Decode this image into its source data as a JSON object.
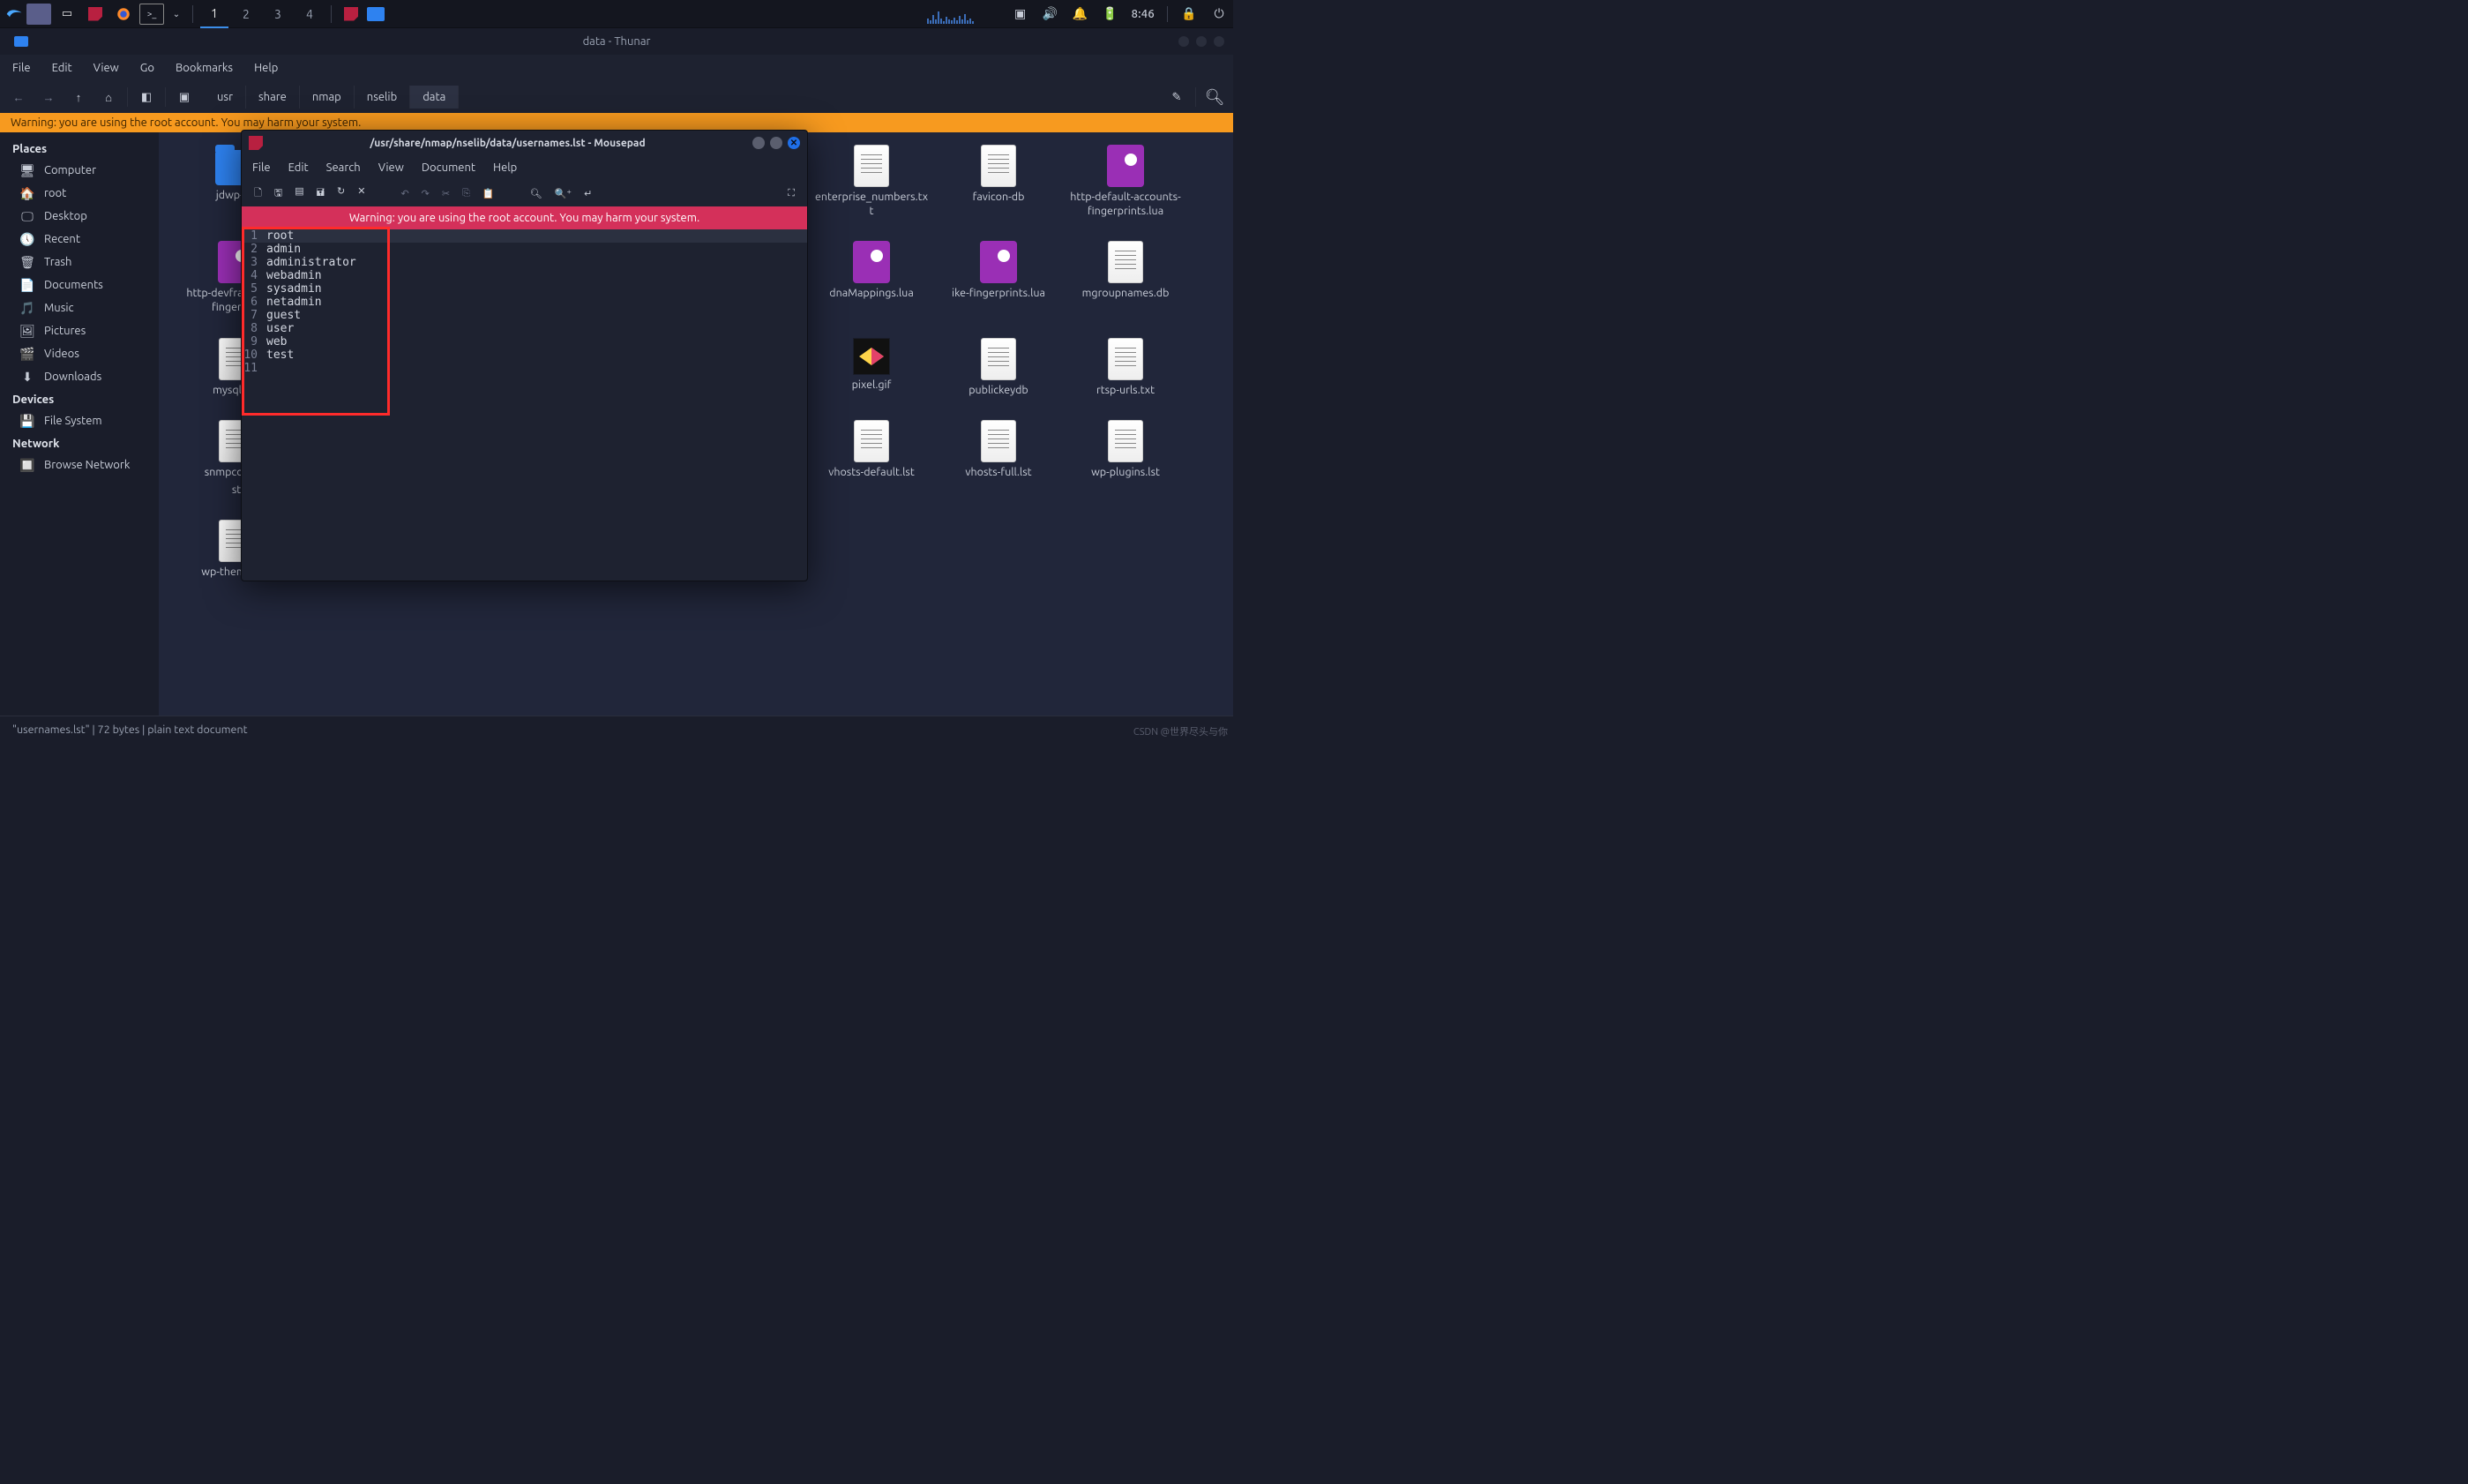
{
  "panel": {
    "workspaces": [
      "1",
      "2",
      "3",
      "4"
    ],
    "active_workspace": 0,
    "clock": "8:46"
  },
  "thunar": {
    "title": "data - Thunar",
    "menu": [
      "File",
      "Edit",
      "View",
      "Go",
      "Bookmarks",
      "Help"
    ],
    "breadcrumbs": [
      "usr",
      "share",
      "nmap",
      "nselib",
      "data"
    ],
    "active_crumb": 4,
    "warning": "Warning: you are using the root account. You may harm your system.",
    "sidebar": {
      "places_header": "Places",
      "places": [
        {
          "icon": "🖥",
          "label": "Computer"
        },
        {
          "icon": "🏠",
          "label": "root"
        },
        {
          "icon": "🖵",
          "label": "Desktop"
        },
        {
          "icon": "🕔",
          "label": "Recent"
        },
        {
          "icon": "🗑",
          "label": "Trash"
        },
        {
          "icon": "📄",
          "label": "Documents"
        },
        {
          "icon": "🎵",
          "label": "Music"
        },
        {
          "icon": "🖼",
          "label": "Pictures"
        },
        {
          "icon": "🎬",
          "label": "Videos"
        },
        {
          "icon": "⬇",
          "label": "Downloads"
        }
      ],
      "devices_header": "Devices",
      "devices": [
        {
          "icon": "💾",
          "label": "File System"
        }
      ],
      "network_header": "Network",
      "network": [
        {
          "icon": "🔲",
          "label": "Browse Network"
        }
      ]
    },
    "files": [
      {
        "type": "folder",
        "label": "jdwp-cla"
      },
      {
        "type": "doc",
        "label": "enterprise_numbers.txt",
        "col": 5
      },
      {
        "type": "doc",
        "label": "favicon-db",
        "col": 6
      },
      {
        "type": "lua",
        "label": "http-default-accounts-fingerprints.lua",
        "col": 7
      },
      {
        "type": "lua",
        "label": "http-devframework-fingerprin",
        "row": 1
      },
      {
        "type": "lua",
        "label": "dnaMappings.lua",
        "row": 1,
        "col": 5
      },
      {
        "type": "lua",
        "label": "ike-fingerprints.lua",
        "row": 1,
        "col": 6
      },
      {
        "type": "doc",
        "label": "mgroupnames.db",
        "row": 1,
        "col": 7
      },
      {
        "type": "doc",
        "label": "mysql-cis.",
        "row": 2
      },
      {
        "type": "gif",
        "label": "pixel.gif",
        "row": 2,
        "col": 5
      },
      {
        "type": "doc",
        "label": "publickeydb",
        "row": 2,
        "col": 6
      },
      {
        "type": "doc",
        "label": "rtsp-urls.txt",
        "row": 2,
        "col": 7
      },
      {
        "type": "doc",
        "label": "snmpcommu",
        "label2": "st",
        "row": 3
      },
      {
        "type": "doc",
        "label": "vhosts-default.lst",
        "row": 3,
        "col": 5
      },
      {
        "type": "doc",
        "label": "vhosts-full.lst",
        "row": 3,
        "col": 6
      },
      {
        "type": "doc",
        "label": "wp-plugins.lst",
        "row": 3,
        "col": 7
      },
      {
        "type": "doc",
        "label": "wp-themes.lst",
        "row": 4
      }
    ],
    "status": "\"usernames.lst\"  |  72 bytes  |  plain text document"
  },
  "mousepad": {
    "title": "/usr/share/nmap/nselib/data/usernames.lst - Mousepad",
    "menu": [
      "File",
      "Edit",
      "Search",
      "View",
      "Document",
      "Help"
    ],
    "warning": "Warning: you are using the root account. You may harm your system.",
    "lines": [
      "root",
      "admin",
      "administrator",
      "webadmin",
      "sysadmin",
      "netadmin",
      "guest",
      "user",
      "web",
      "test",
      ""
    ]
  },
  "watermark": "CSDN @世界尽头与你"
}
